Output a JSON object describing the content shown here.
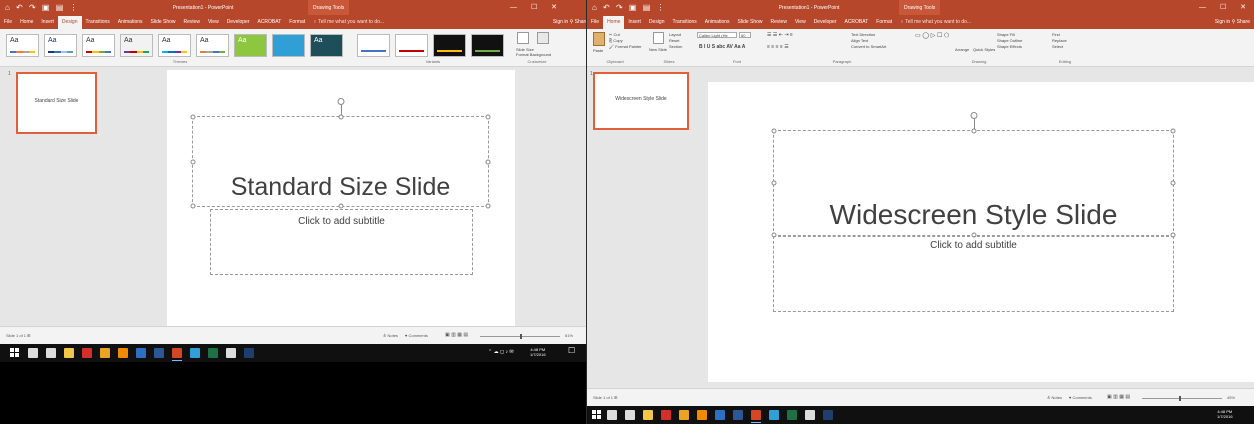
{
  "left_window": {
    "title": "Presentation1 - PowerPoint",
    "context_tab": "Drawing Tools",
    "qat": "⌂ ↶ ↷ ▣ ▤ ⋮",
    "window_controls": "— ☐ ✕",
    "tabs": [
      "File",
      "Home",
      "Insert",
      "Design",
      "Transitions",
      "Animations",
      "Slide Show",
      "Review",
      "View",
      "Developer",
      "ACROBAT",
      "Format"
    ],
    "active_tab": "Design",
    "tell_me": "♀ Tell me what you want to do...",
    "signin": "Sign in  ⚲ Share",
    "ribbon": {
      "themes_group": "Themes",
      "variants_group": "Variants",
      "customize_group": "Customize",
      "themes": [
        {
          "label": "Aa",
          "bg": "#ffffff",
          "fg": "#333333",
          "bar": [
            "#4472c4",
            "#ed7d31",
            "#a5a5a5",
            "#ffc000"
          ]
        },
        {
          "label": "Aa",
          "bg": "#ffffff",
          "fg": "#1f3864",
          "bar": [
            "#1f3864",
            "#2e75b6",
            "#9dc3e6",
            "#5b9bd5"
          ]
        },
        {
          "label": "Aa",
          "bg": "#ffffff",
          "fg": "#333333",
          "bar": [
            "#c00000",
            "#ffc000",
            "#70ad47",
            "#4472c4"
          ]
        },
        {
          "label": "Aa",
          "bg": "#f2f2f2",
          "fg": "#333333",
          "bar": [
            "#7030a0",
            "#c00000",
            "#ffc000",
            "#00b050"
          ]
        },
        {
          "label": "Aa",
          "bg": "#ffffff",
          "fg": "#333333",
          "bar": [
            "#00b0f0",
            "#0070c0",
            "#7030a0",
            "#ffc000"
          ]
        },
        {
          "label": "Aa",
          "bg": "#ffffff",
          "fg": "#333333",
          "bar": [
            "#ed7d31",
            "#a5a5a5",
            "#4472c4",
            "#70ad47"
          ]
        },
        {
          "label": "Aa",
          "bg": "#8dc63f",
          "fg": "#ffffff",
          "bar": [
            "#8dc63f",
            "#8dc63f",
            "#8dc63f",
            "#8dc63f"
          ]
        },
        {
          "label": "",
          "bg": "#2f9fd6",
          "fg": "#ffffff",
          "bar": [
            "#2f9fd6",
            "#2f9fd6",
            "#2f9fd6",
            "#2f9fd6"
          ]
        },
        {
          "label": "Aa",
          "bg": "#1e4e5a",
          "fg": "#ffffff",
          "bar": [
            "#1e4e5a",
            "#1e4e5a",
            "#1e4e5a",
            "#1e4e5a"
          ]
        }
      ],
      "variants": [
        {
          "bg": "#ffffff",
          "bar": "#4472c4"
        },
        {
          "bg": "#ffffff",
          "bar": "#c00000"
        },
        {
          "bg": "#111111",
          "bar": "#ffc000"
        },
        {
          "bg": "#111111",
          "bar": "#70ad47"
        }
      ],
      "slide_size": "Slide Size",
      "format_background": "Format Background"
    },
    "thumb_number": "1",
    "thumb_text": "Standard Size Slide",
    "slide_title": "Standard Size Slide",
    "slide_subtitle": "Click to add subtitle",
    "status_left": "Slide 1 of 1   ⊞",
    "status_notes": "≙ Notes",
    "status_comments": "♥ Comments",
    "status_zoom": "61%",
    "taskbar_time": "4:48 PM",
    "taskbar_date": "1/7/2016"
  },
  "right_window": {
    "title": "Presentation1 - PowerPoint",
    "context_tab": "Drawing Tools",
    "qat": "⌂ ↶ ↷ ▣ ▤ ⋮",
    "window_controls": "— ☐ ✕",
    "tabs": [
      "File",
      "Home",
      "Insert",
      "Design",
      "Transitions",
      "Animations",
      "Slide Show",
      "Review",
      "View",
      "Developer",
      "ACROBAT",
      "Format"
    ],
    "active_tab": "Home",
    "tell_me": "♀ Tell me what you want to do...",
    "signin": "Sign in  ⚲ Share",
    "ribbon": {
      "paste": "Paste",
      "cut": "✂ Cut",
      "copy": "⎘ Copy",
      "format_painter": "🖌 Format Painter",
      "new_slide": "New Slide",
      "layout": "Layout",
      "reset": "Reset",
      "section": "Section",
      "font_name": "Calibri Light (He",
      "font_size": "60",
      "text_direction": "Text Direction",
      "align_text": "Align Text",
      "convert_smartart": "Convert to SmartArt",
      "arrange": "Arrange",
      "quick_styles": "Quick Styles",
      "shape_fill": "Shape Fill",
      "shape_outline": "Shape Outline",
      "shape_effects": "Shape Effects",
      "find": "Find",
      "replace": "Replace",
      "select": "Select",
      "groups": [
        "Clipboard",
        "Slides",
        "Font",
        "Paragraph",
        "Drawing",
        "Editing"
      ]
    },
    "thumb_number": "1",
    "thumb_text": "Widescreen Style Slide",
    "slide_title": "Widescreen Style Slide",
    "slide_subtitle": "Click to add subtitle",
    "status_left": "Slide 1 of 1   ⊞",
    "status_notes": "≙ Notes",
    "status_comments": "♥ Comments",
    "status_zoom": "45%",
    "taskbar_time": "4:48 PM",
    "taskbar_date": "1/7/2016"
  },
  "taskbar_icons": [
    {
      "name": "search-icon",
      "color": "#dddddd"
    },
    {
      "name": "task-view-icon",
      "color": "#dddddd"
    },
    {
      "name": "file-explorer-icon",
      "color": "#f3c64a"
    },
    {
      "name": "acrobat-icon",
      "color": "#d4302a"
    },
    {
      "name": "chrome-icon",
      "color": "#e9a423"
    },
    {
      "name": "vlc-icon",
      "color": "#f08a00"
    },
    {
      "name": "outlook-icon",
      "color": "#2f6fc1"
    },
    {
      "name": "word-icon",
      "color": "#2b5797"
    },
    {
      "name": "powerpoint-icon",
      "color": "#d24726"
    },
    {
      "name": "browser-icon",
      "color": "#2fa0d8"
    },
    {
      "name": "excel-icon",
      "color": "#1e7145"
    },
    {
      "name": "calculator-icon",
      "color": "#dddddd"
    },
    {
      "name": "photoshop-icon",
      "color": "#1e3f6e"
    }
  ],
  "colors": {
    "accent": "#b7472a",
    "thumb_border": "#e0603a"
  }
}
